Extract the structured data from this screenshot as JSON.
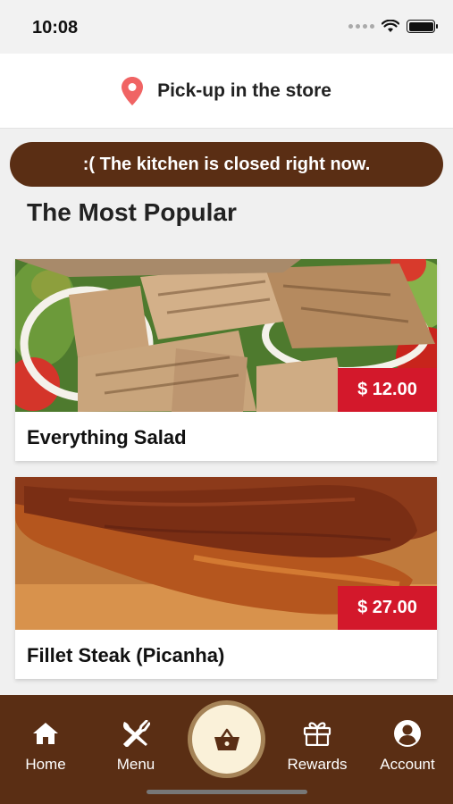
{
  "status_bar": {
    "time": "10:08"
  },
  "header": {
    "pickup_label": "Pick-up in the store"
  },
  "banner": {
    "text": ":( The kitchen is closed right now."
  },
  "section": {
    "title": "The Most Popular"
  },
  "products": [
    {
      "name": "Everything Salad",
      "price": "$ 12.00",
      "image": "grilled-chicken-salad"
    },
    {
      "name": "Fillet Steak (Picanha)",
      "price": "$ 27.00",
      "image": "grilled-steak"
    }
  ],
  "nav": {
    "items": [
      {
        "label": "Home",
        "icon": "home-icon"
      },
      {
        "label": "Menu",
        "icon": "fork-knife-icon"
      },
      {
        "label": "",
        "icon": "basket-icon"
      },
      {
        "label": "Rewards",
        "icon": "gift-icon"
      },
      {
        "label": "Account",
        "icon": "account-icon"
      }
    ]
  },
  "colors": {
    "brand_brown": "#5a2e14",
    "price_red": "#d3182b",
    "basket_bg": "#faf1d9",
    "basket_ring": "#a58357",
    "pin_red": "#f06464"
  }
}
